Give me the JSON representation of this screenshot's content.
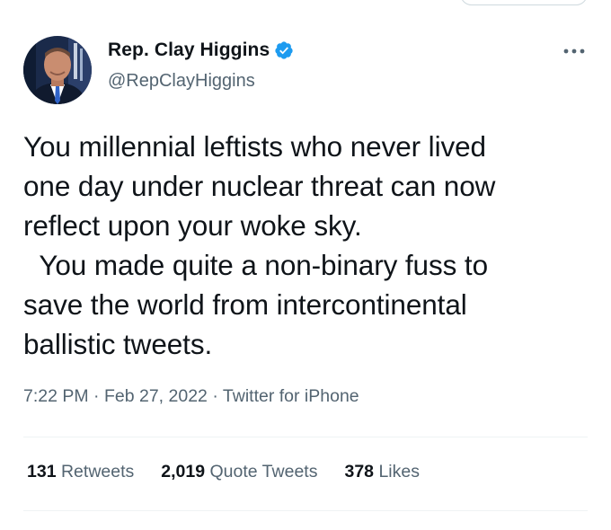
{
  "tweet": {
    "author": {
      "display_name": "Rep. Clay Higgins",
      "handle": "@RepClayHiggins",
      "verified": true
    },
    "text": "You millennial leftists who never lived\none day under nuclear threat can now\nreflect upon your woke sky.\n  You made quite a non-binary fuss to\nsave the world from intercontinental\nballistic tweets.",
    "time": "7:22 PM",
    "date": "Feb 27, 2022",
    "source": "Twitter for iPhone",
    "separator": "·",
    "stats": {
      "retweets_count": "131",
      "retweets_label": "Retweets",
      "quote_tweets_count": "2,019",
      "quote_tweets_label": "Quote Tweets",
      "likes_count": "378",
      "likes_label": "Likes"
    }
  },
  "icons": {
    "verified": "verified-badge-icon",
    "more": "more-options-icon"
  },
  "colors": {
    "text_primary": "#0f1419",
    "text_secondary": "#536471",
    "verified_blue": "#1d9bf0",
    "divider": "#eff3f4"
  }
}
